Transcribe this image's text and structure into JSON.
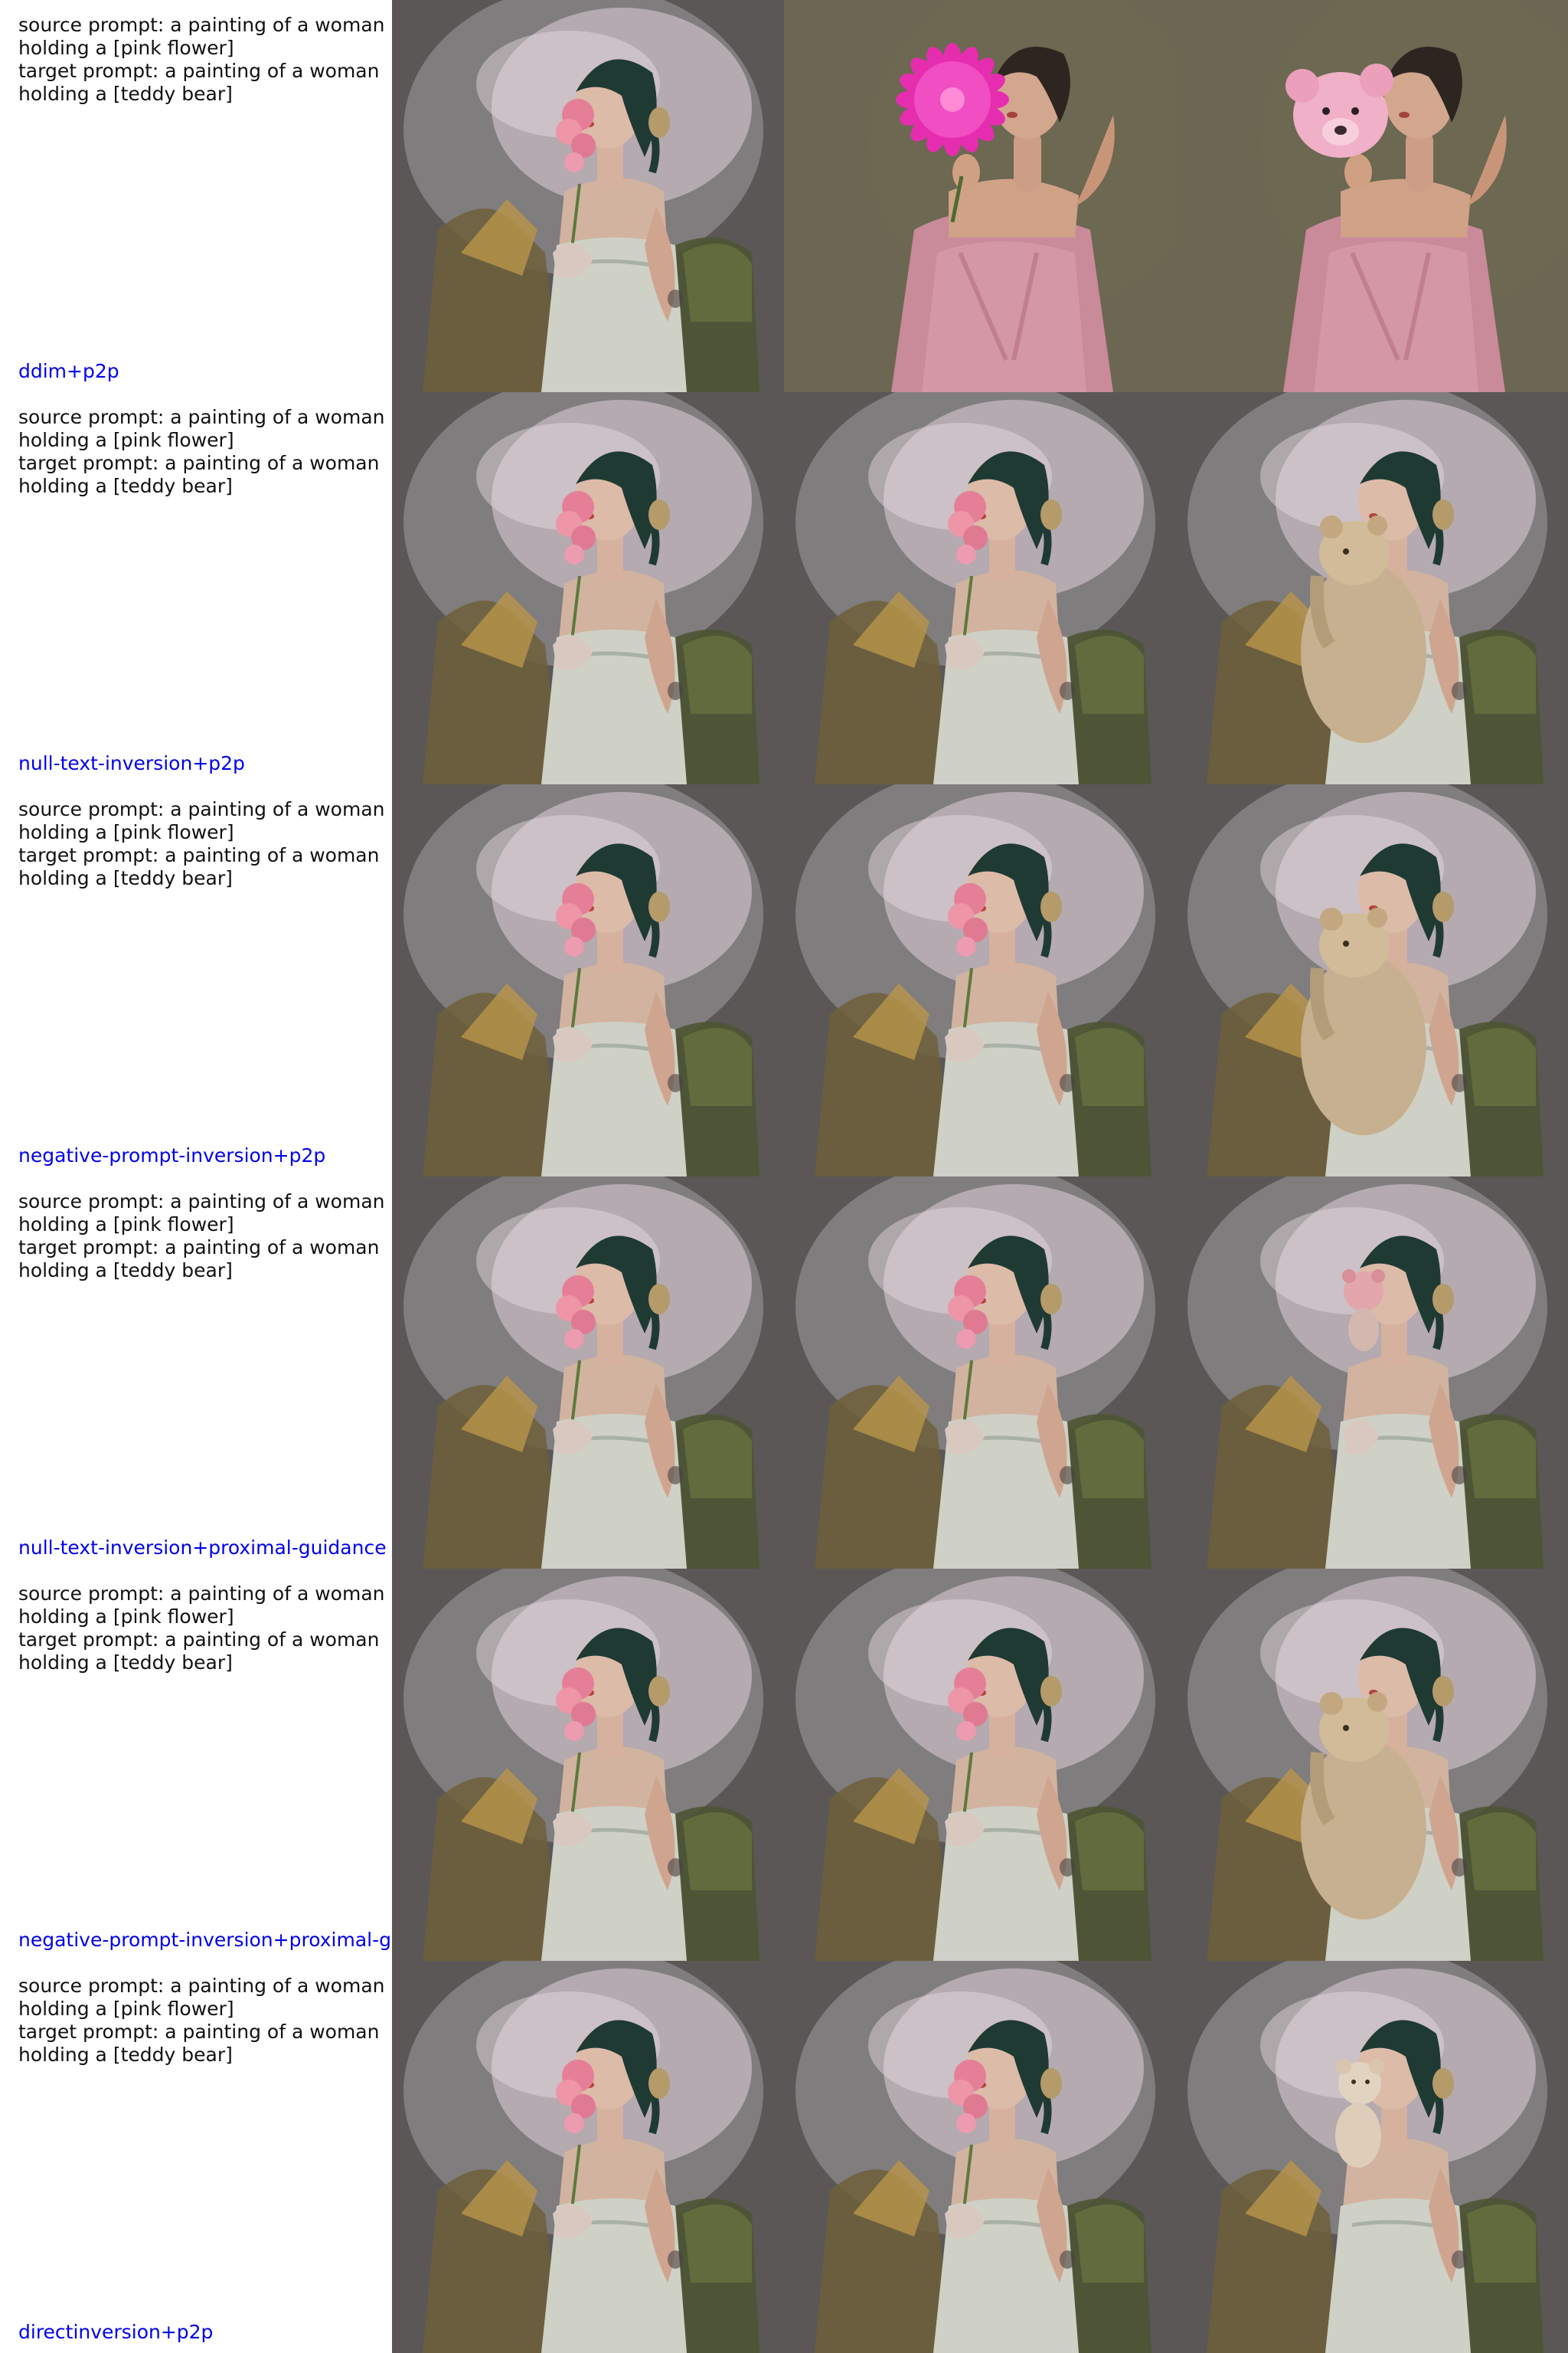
{
  "figure": {
    "method_label_color": "#0000ee",
    "rows": [
      {
        "prompt": "source prompt: a painting of a woman\nholding a [pink flower]\ntarget prompt: a painting of a woman\nholding a [teddy bear]",
        "method": "ddim+p2p",
        "images": [
          {
            "subject": "woman smelling a pink flower, sketchy painted style",
            "style": "sketch",
            "held_object": "flower"
          },
          {
            "subject": "woman in pink dress holding a magenta flower",
            "style": "oil",
            "held_object": "magenta-flower"
          },
          {
            "subject": "woman in pink dress holding a pink teddy bear",
            "style": "oil",
            "held_object": "pink-bear"
          }
        ]
      },
      {
        "prompt": "source prompt: a painting of a woman\nholding a [pink flower]\ntarget prompt: a painting of a woman\nholding a [teddy bear]",
        "method": "null-text-inversion+p2p",
        "images": [
          {
            "subject": "woman smelling a pink flower",
            "style": "sketch",
            "held_object": "flower"
          },
          {
            "subject": "woman smelling a pink flower",
            "style": "sketch",
            "held_object": "flower"
          },
          {
            "subject": "woman holding a large beige teddy bear",
            "style": "sketch",
            "held_object": "large-bear"
          }
        ]
      },
      {
        "prompt": "source prompt: a painting of a woman\nholding a [pink flower]\ntarget prompt: a painting of a woman\nholding a [teddy bear]",
        "method": "negative-prompt-inversion+p2p",
        "images": [
          {
            "subject": "woman smelling a pink flower",
            "style": "sketch",
            "held_object": "flower"
          },
          {
            "subject": "woman smelling a pink flower",
            "style": "sketch",
            "held_object": "flower"
          },
          {
            "subject": "woman holding a large beige teddy bear",
            "style": "sketch",
            "held_object": "large-bear"
          }
        ]
      },
      {
        "prompt": "source prompt: a painting of a woman\nholding a [pink flower]\ntarget prompt: a painting of a woman\nholding a [teddy bear]",
        "method": "null-text-inversion+proximal-guidance",
        "images": [
          {
            "subject": "woman smelling a pink flower",
            "style": "sketch",
            "held_object": "flower"
          },
          {
            "subject": "woman smelling a pink flower",
            "style": "sketch",
            "held_object": "flower"
          },
          {
            "subject": "woman holding a small pink teddy bear",
            "style": "sketch",
            "held_object": "small-pink-bear"
          }
        ]
      },
      {
        "prompt": "source prompt: a painting of a woman\nholding a [pink flower]\ntarget prompt: a painting of a woman\nholding a [teddy bear]",
        "method": "negative-prompt-inversion+proximal-g",
        "images": [
          {
            "subject": "woman smelling a pink flower",
            "style": "sketch",
            "held_object": "flower"
          },
          {
            "subject": "woman smelling a pink flower",
            "style": "sketch",
            "held_object": "flower"
          },
          {
            "subject": "woman holding a large beige teddy bear",
            "style": "sketch",
            "held_object": "large-bear"
          }
        ]
      },
      {
        "prompt": "source prompt: a painting of a woman\nholding a [pink flower]\ntarget prompt: a painting of a woman\nholding a [teddy bear]",
        "method": "directinversion+p2p",
        "images": [
          {
            "subject": "woman smelling a pink flower",
            "style": "sketch",
            "held_object": "flower"
          },
          {
            "subject": "woman smelling a pink flower",
            "style": "sketch",
            "held_object": "flower"
          },
          {
            "subject": "woman holding a small cream teddy bear",
            "style": "sketch",
            "held_object": "small-bear"
          }
        ]
      }
    ]
  }
}
